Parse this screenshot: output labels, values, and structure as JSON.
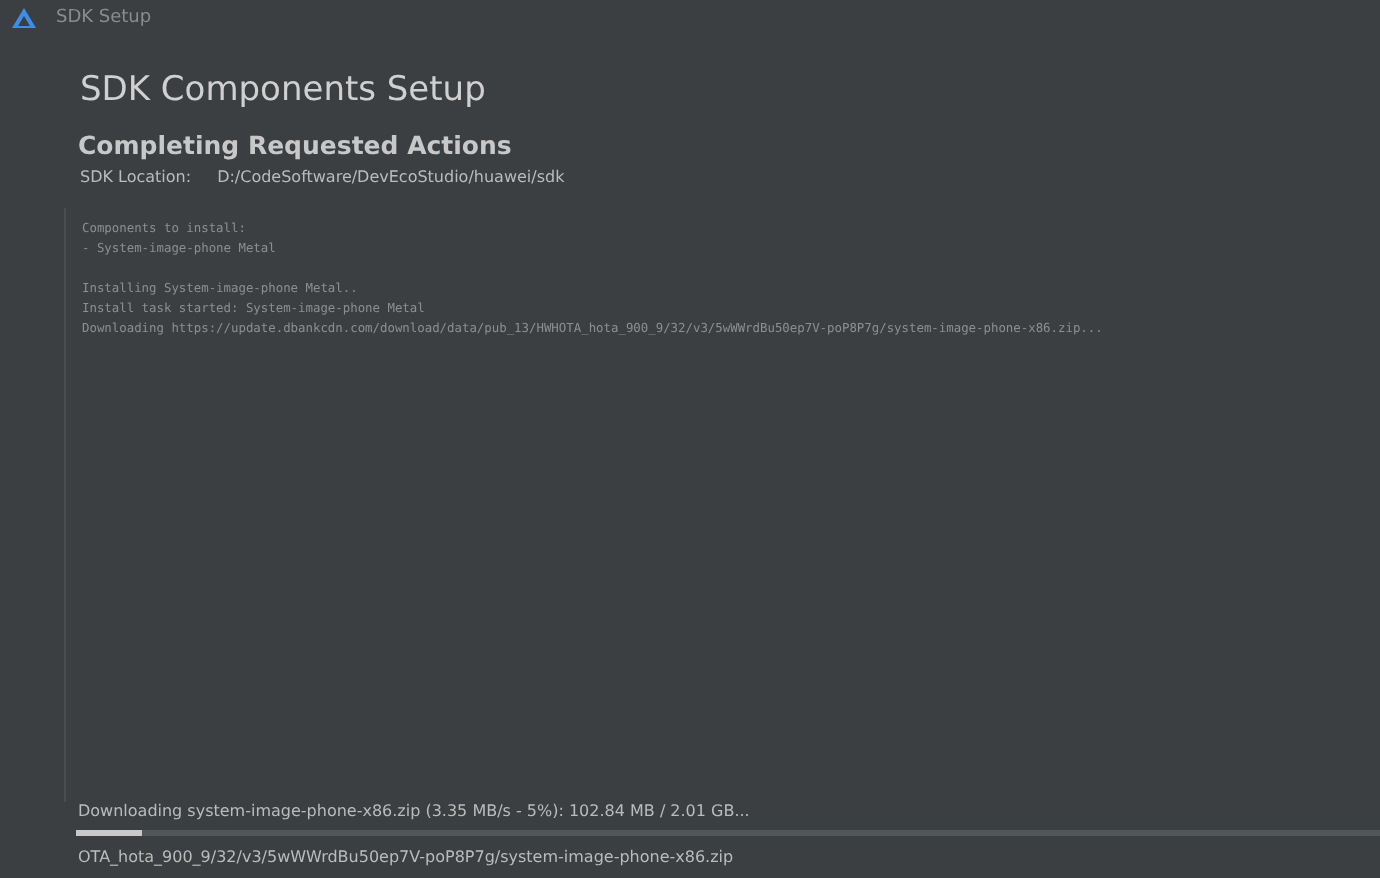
{
  "window": {
    "title": "SDK Setup"
  },
  "header": {
    "title": "SDK Components Setup",
    "subtitle": "Completing Requested Actions",
    "location_label": "SDK Location:",
    "location_value": "D:/CodeSoftware/DevEcoStudio/huawei/sdk"
  },
  "log": {
    "blocks": [
      [
        "Components to install:",
        "- System-image-phone Metal"
      ],
      [
        "Installing System-image-phone Metal..",
        "Install task started: System-image-phone Metal",
        "Downloading https://update.dbankcdn.com/download/data/pub_13/HWHOTA_hota_900_9/32/v3/5wWWrdBu50ep7V-poP8P7g/system-image-phone-x86.zip..."
      ]
    ]
  },
  "progress": {
    "status": "Downloading system-image-phone-x86.zip (3.35 MB/s - 5%): 102.84 MB / 2.01 GB...",
    "level": 0.05,
    "detail": "OTA_hota_900_9/32/v3/5wWWrdBu50ep7V-poP8P7g/system-image-phone-x86.zip"
  }
}
